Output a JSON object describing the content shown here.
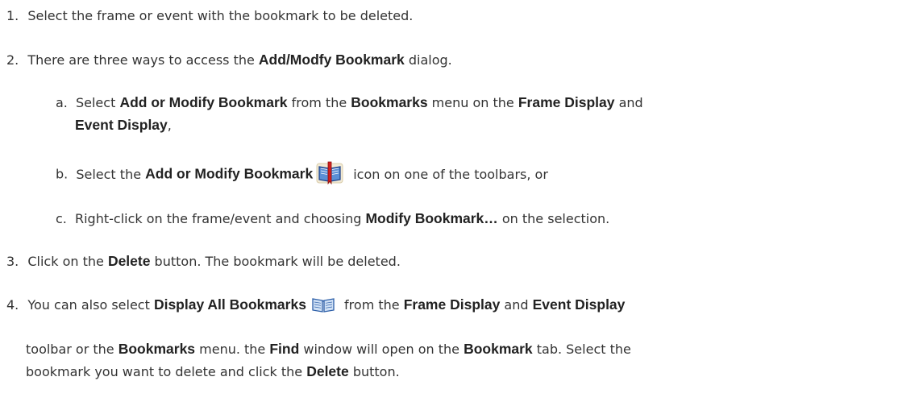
{
  "steps": {
    "s1": {
      "num": "1.",
      "text": "Select the frame or event with the bookmark to be deleted."
    },
    "s2": {
      "num": "2.",
      "pre": "There are three ways to access the ",
      "b1": "Add/Modfy Bookmark",
      "post": " dialog."
    },
    "s2a": {
      "letter": "a.",
      "pre": "Select ",
      "b1": "Add or Modify Bookmark",
      "mid1": " from the ",
      "b2": "Bookmarks",
      "mid2": " menu on the ",
      "b3": "Frame Display",
      "mid3": " and",
      "b4": "Event Display",
      "post": ","
    },
    "s2b": {
      "letter": "b.",
      "pre": "Select the ",
      "b1": "Add or Modify Bookmark",
      "post": "icon on one of the toolbars, or"
    },
    "s2c": {
      "letter": "c.",
      "pre": "Right-click on the frame/event and choosing ",
      "b1": "Modify Bookmark…",
      "post": " on the selection."
    },
    "s3": {
      "num": "3.",
      "pre": "Click on the ",
      "b1": "Delete",
      "post": " button. The bookmark will be deleted."
    },
    "s4": {
      "num": "4.",
      "pre": "You can also select ",
      "b1": "Display All Bookmarks",
      "mid1": " from the ",
      "b2": "Frame Display",
      "mid2": " and ",
      "b3": "Event Display",
      "line2_pre": "toolbar or the ",
      "line2_b1": "Bookmarks",
      "line2_mid1": " menu. the ",
      "line2_b2": "Find",
      "line2_mid2": " window will open on the ",
      "line2_b3": "Bookmark",
      "line2_post": " tab. Select the",
      "line3_pre": "bookmark you want to delete and click the ",
      "line3_b1": "Delete",
      "line3_post": " button."
    }
  },
  "icons": {
    "add_modify_bookmark": "book-with-red-ribbon-icon",
    "display_all_bookmarks": "open-book-icon"
  }
}
